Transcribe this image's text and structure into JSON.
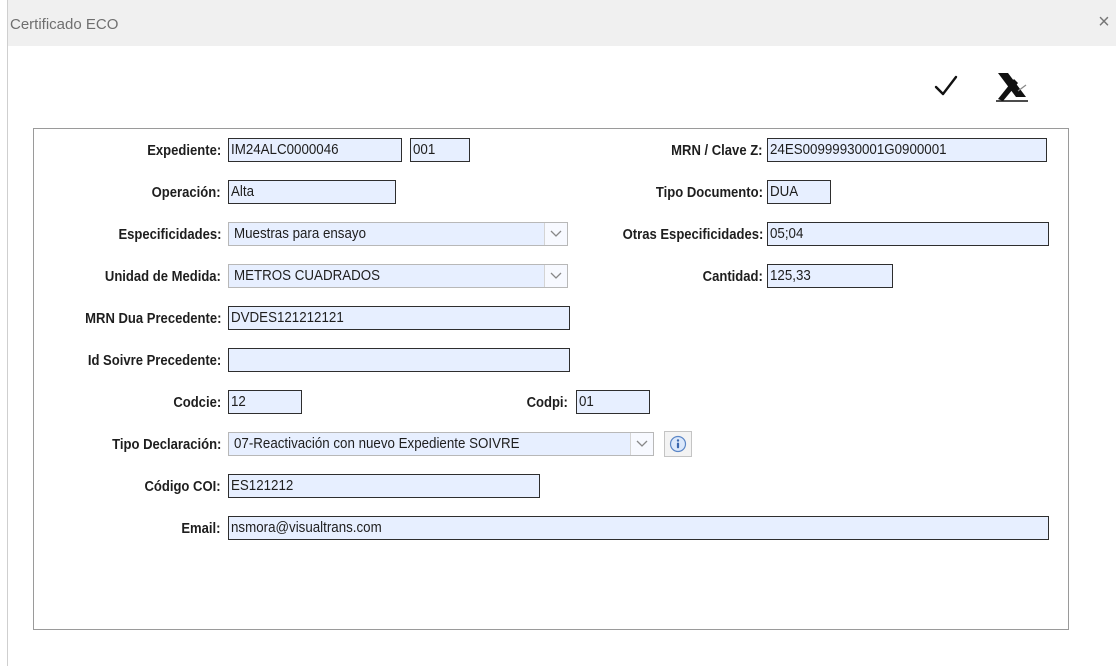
{
  "window": {
    "title": "Certificado ECO",
    "close_symbol": "×"
  },
  "toolbar": {
    "accept_icon": "checkmark-icon",
    "cancel_icon": "cancel-pen-icon"
  },
  "form": {
    "expediente": {
      "label": "Expediente:",
      "value": "IM24ALC0000046",
      "suffix": "001"
    },
    "mrn_clave": {
      "label": "MRN / Clave Z:",
      "value": "24ES00999930001G0900001"
    },
    "operacion": {
      "label": "Operación:",
      "value": "Alta"
    },
    "tipo_documento": {
      "label": "Tipo Documento:",
      "value": "DUA"
    },
    "especificidades": {
      "label": "Especificidades:",
      "value": "Muestras para ensayo"
    },
    "otras_especificidades": {
      "label": "Otras Especificidades:",
      "value": "05;04"
    },
    "unidad_medida": {
      "label": "Unidad de Medida:",
      "value": "METROS CUADRADOS"
    },
    "cantidad": {
      "label": "Cantidad:",
      "value": "125,33"
    },
    "mrn_dua_precedente": {
      "label": "MRN Dua Precedente:",
      "value": "DVDES121212121"
    },
    "id_soivre_precedente": {
      "label": "Id Soivre Precedente:",
      "value": ""
    },
    "codcie": {
      "label": "Codcie:",
      "value": "12"
    },
    "codpi": {
      "label": "Codpi:",
      "value": "01"
    },
    "tipo_declaracion": {
      "label": "Tipo Declaración:",
      "value": "07-Reactivación con nuevo Expediente SOIVRE"
    },
    "codigo_coi": {
      "label": "Código COI:",
      "value": "ES121212"
    },
    "email": {
      "label": "Email:",
      "value": "nsmora@visualtrans.com"
    }
  }
}
